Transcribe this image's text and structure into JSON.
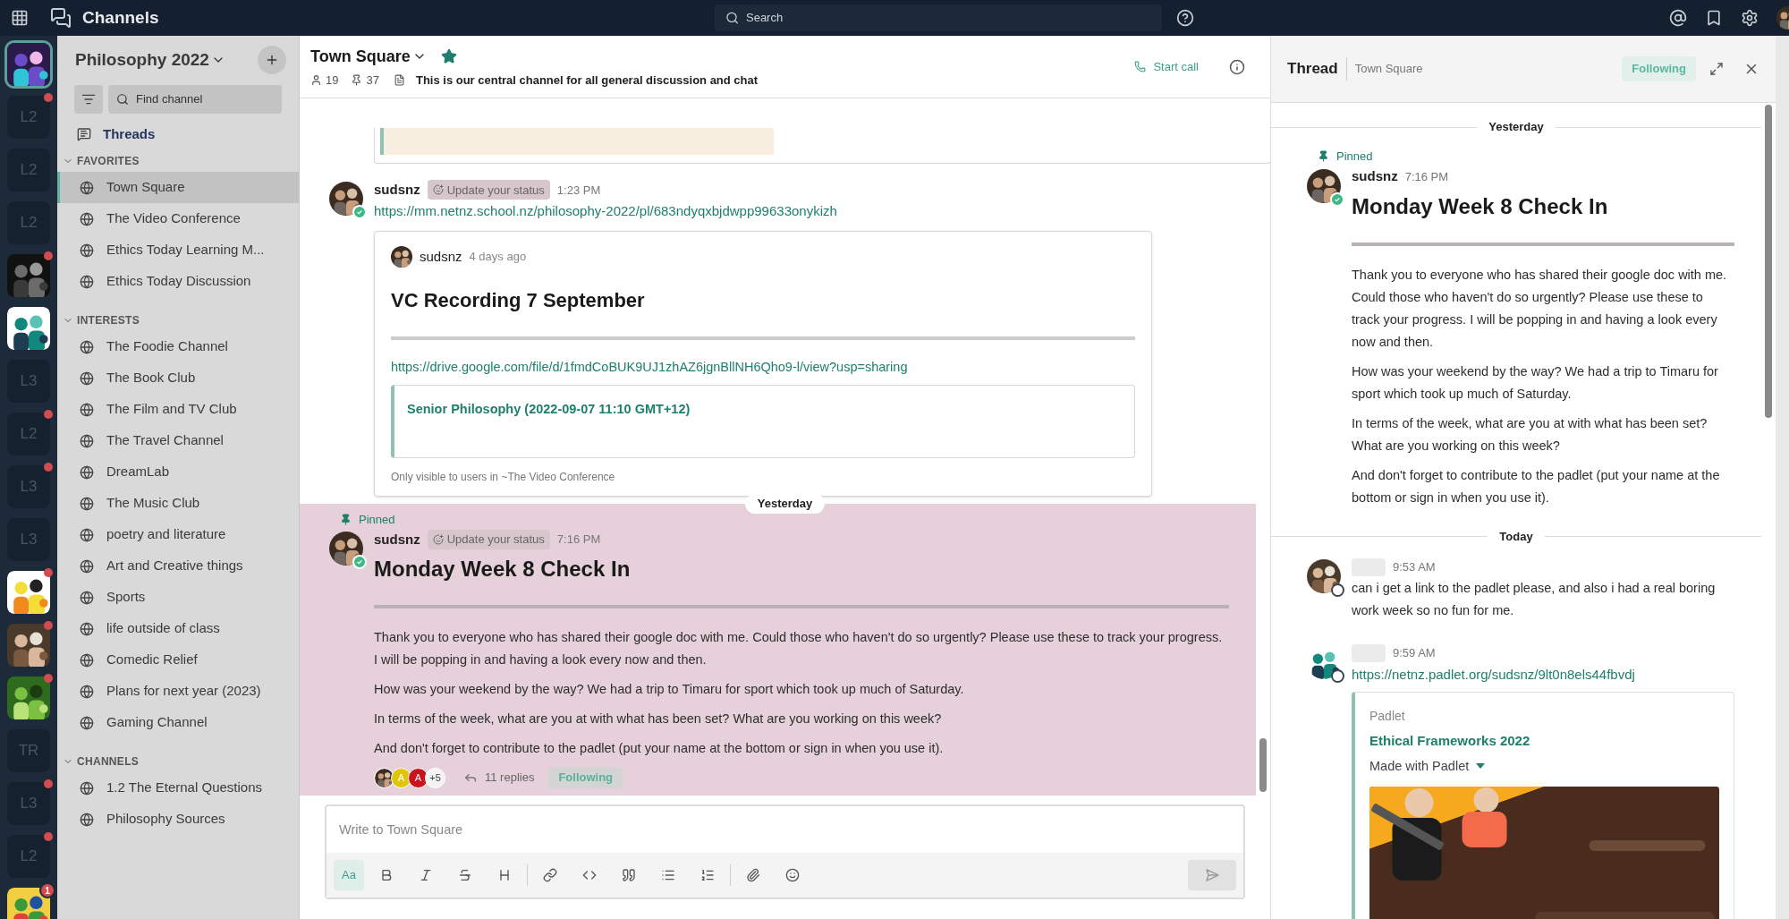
{
  "top_bar": {
    "app_title": "Channels",
    "search": {
      "placeholder": "Search"
    }
  },
  "team_sidebar": [
    {
      "kind": "picture",
      "selected": true,
      "unread": false
    },
    {
      "kind": "initials",
      "text": "L2",
      "selected": false,
      "unread": true
    },
    {
      "kind": "initials",
      "text": "L2",
      "selected": false,
      "unread": false
    },
    {
      "kind": "initials",
      "text": "L2",
      "selected": false,
      "unread": false
    },
    {
      "kind": "picture",
      "selected": false,
      "unread": true
    },
    {
      "kind": "picture",
      "selected": false,
      "unread": false
    },
    {
      "kind": "initials",
      "text": "L3",
      "selected": false,
      "unread": false
    },
    {
      "kind": "initials",
      "text": "L2",
      "selected": false,
      "unread": true
    },
    {
      "kind": "initials",
      "text": "L3",
      "selected": false,
      "unread": true
    },
    {
      "kind": "initials",
      "text": "L3",
      "selected": false,
      "unread": false
    },
    {
      "kind": "picture",
      "selected": false,
      "unread": true
    },
    {
      "kind": "picture",
      "selected": false,
      "unread": true
    },
    {
      "kind": "picture",
      "selected": false,
      "unread": true
    },
    {
      "kind": "initials",
      "text": "TR",
      "selected": false,
      "unread": false
    },
    {
      "kind": "initials",
      "text": "L3",
      "selected": false,
      "unread": true
    },
    {
      "kind": "initials",
      "text": "L2",
      "selected": false,
      "unread": true
    },
    {
      "kind": "picture",
      "selected": false,
      "unread": false,
      "badge": "1"
    }
  ],
  "channel_sidebar": {
    "team_name": "Philosophy 2022",
    "find": {
      "placeholder": "Find channel"
    },
    "threads": "Threads",
    "sections": [
      {
        "title": "FAVORITES",
        "channels": [
          {
            "name": "Town Square",
            "selected": true
          },
          {
            "name": "The Video Conference",
            "selected": false
          },
          {
            "name": "Ethics Today Learning M...",
            "selected": false
          },
          {
            "name": "Ethics Today Discussion",
            "selected": false
          }
        ]
      },
      {
        "title": "INTERESTS",
        "channels": [
          {
            "name": "The Foodie Channel",
            "selected": false
          },
          {
            "name": "The Book Club",
            "selected": false
          },
          {
            "name": "The Film and TV Club",
            "selected": false
          },
          {
            "name": "The Travel Channel",
            "selected": false
          },
          {
            "name": "DreamLab",
            "selected": false
          },
          {
            "name": "The Music Club",
            "selected": false
          },
          {
            "name": "poetry and literature",
            "selected": false
          },
          {
            "name": "Art and Creative things",
            "selected": false
          },
          {
            "name": "Sports",
            "selected": false
          },
          {
            "name": "life outside of class",
            "selected": false
          },
          {
            "name": "Comedic Relief",
            "selected": false
          },
          {
            "name": "Plans for next year (2023)",
            "selected": false
          },
          {
            "name": "Gaming Channel",
            "selected": false
          }
        ]
      },
      {
        "title": "CHANNELS",
        "channels": [
          {
            "name": "1.2 The Eternal Questions",
            "selected": false
          },
          {
            "name": "Philosophy Sources",
            "selected": false
          }
        ]
      }
    ]
  },
  "channel_header": {
    "name": "Town Square",
    "favorite": true,
    "members": "19",
    "pinned": "37",
    "purpose": "This is our central channel for all general discussion and chat",
    "call_button": "Start call"
  },
  "center": [
    {
      "kind": "post",
      "highlighted": false,
      "author": "sudsnz",
      "online": true,
      "status_badge": "Update your status",
      "time": "1:23 PM",
      "link": "https://mm.netnz.school.nz/philosophy-2022/pl/683ndyqxbjdwpp99633onykizh",
      "permalink": {
        "author": "sudsnz",
        "time": "4 days ago",
        "title": "VC Recording 7 September",
        "link": "https://drive.google.com/file/d/1fmdCoBUK9UJ1zhAZ6jgnBllNH6Qho9-l/view?usp=sharing",
        "attachment_title": "Senior Philosophy (2022-09-07 11:10 GMT+12)",
        "footer": "Only visible to users in ~The Video Conference"
      }
    },
    {
      "kind": "date",
      "text": "Yesterday"
    },
    {
      "kind": "post",
      "highlighted": true,
      "pinned": "Pinned",
      "author": "sudsnz",
      "online": true,
      "status_badge": "Update your status",
      "time": "7:16 PM",
      "title": "Monday Week 8 Check In",
      "paragraphs": [
        "Thank you to everyone who has shared their google doc with me. Could those who haven't do so urgently? Please use these to track your progress. I will be popping in and having a look every now and then.",
        "How was your weekend by the way? We had a trip to Timaru for sport which took up much of Saturday.",
        "In terms of the week, what are you at with what has been set? What are you working on this week?",
        "And don't forget to contribute to the padlet (put your name at the bottom or sign in when you use it)."
      ],
      "participants": [
        {
          "kind": "picture"
        },
        {
          "kind": "initial",
          "text": "A",
          "color": "#e0c60b"
        },
        {
          "kind": "initial",
          "text": "A",
          "color": "#c8141d"
        },
        {
          "kind": "count",
          "text": "+5"
        }
      ],
      "replies": "11 replies",
      "follow": "Following"
    }
  ],
  "message_input": {
    "placeholder": "Write to Town Square",
    "format_toggle": "Aa"
  },
  "thread": {
    "title": "Thread",
    "channel": "Town Square",
    "follow": "Following",
    "items": [
      {
        "kind": "date",
        "text": "Yesterday"
      },
      {
        "kind": "post",
        "pinned": "Pinned",
        "author": "sudsnz",
        "online": true,
        "time": "7:16 PM",
        "title": "Monday Week 8 Check In",
        "paragraphs": [
          "Thank you to everyone who has shared their google doc with me. Could those who haven't do so urgently? Please use these to track your progress. I will be popping in and having a look every now and then.",
          "How was your weekend by the way? We had a trip to Timaru for sport which took up much of Saturday.",
          "In terms of the week, what are you at with what has been set? What are you working on this week?",
          "And don't forget to contribute to the padlet (put your name at the bottom or sign in when you use it)."
        ]
      },
      {
        "kind": "date",
        "text": "Today"
      },
      {
        "kind": "post",
        "online": false,
        "time": "9:53 AM",
        "paragraphs": [
          "can i get a link to the padlet please, and also i had a real boring work week so no fun for me."
        ]
      },
      {
        "kind": "post",
        "online": false,
        "time": "9:59 AM",
        "link": "https://netnz.padlet.org/sudsnz/9lt0n8els44fbvdj",
        "embed": {
          "site": "Padlet",
          "title": "Ethical Frameworks 2022",
          "subtitle": "Made with Padlet",
          "image": {
            "kind": "picture"
          }
        }
      }
    ]
  }
}
